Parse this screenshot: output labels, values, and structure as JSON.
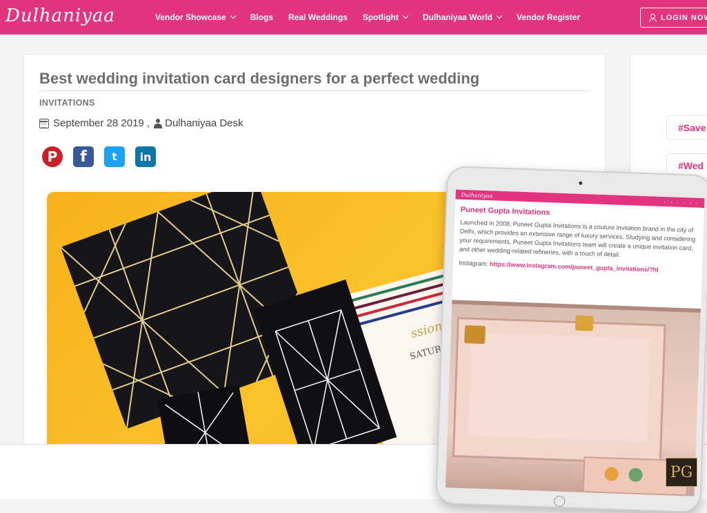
{
  "header": {
    "logo": "Dulhaniyaa",
    "nav": [
      {
        "label": "Vendor Showcase",
        "dropdown": true
      },
      {
        "label": "Blogs",
        "dropdown": false
      },
      {
        "label": "Real Weddings",
        "dropdown": false
      },
      {
        "label": "Spotlight",
        "dropdown": true
      },
      {
        "label": "Dulhaniyaa World",
        "dropdown": true
      },
      {
        "label": "Vendor Register",
        "dropdown": false
      }
    ],
    "login_label": "LOGIN NOW"
  },
  "article": {
    "title": "Best wedding invitation card designers for a perfect wedding",
    "category": "INVITATIONS",
    "date": "September 28 2019 ,",
    "author": "Dulhaniyaa Desk",
    "share": {
      "pinterest": "P",
      "facebook": "f",
      "twitter": "t",
      "linkedin": "in"
    }
  },
  "sidebar": {
    "tags": [
      "#Save",
      "#Wed"
    ]
  },
  "tablet": {
    "logo": "Dulhaniyaa",
    "heading": "Puneet Gupta Invitations",
    "body": "Launched in 2008, Puneet Gupta Invitations is a couture invitation brand in the city of Delhi, which provides an extensive range of luxury services. Studying and considering your requirements, Puneet Gupta Invitations team will create a unique invitation card, and other wedding-related refineries, with a touch of detail.",
    "instagram_label": "Instagram:",
    "instagram_link": "https://www.instagram.com/puneet_gupta_invitations/?hl"
  },
  "badge": "PG",
  "colors": {
    "brand": "#e33480",
    "hero": "#f6b21b"
  }
}
